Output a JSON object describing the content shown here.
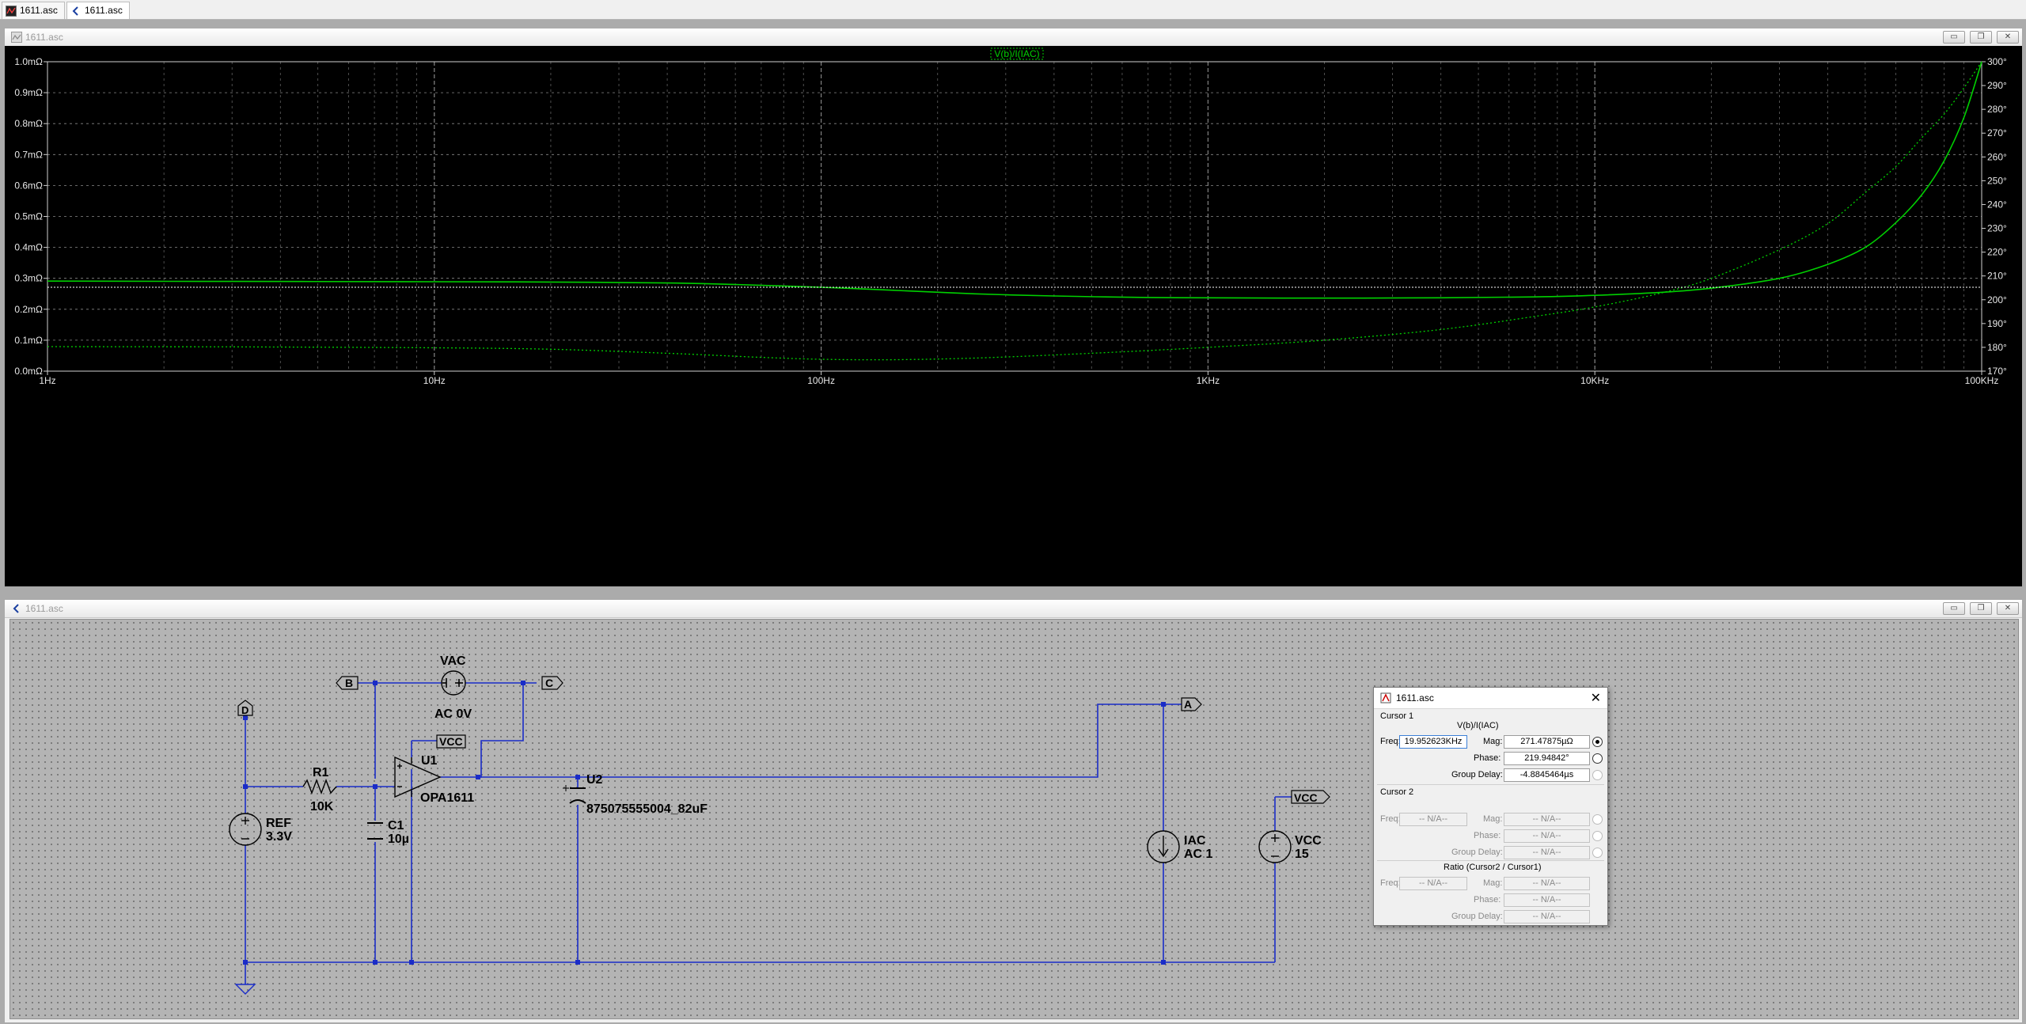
{
  "tabs": [
    {
      "label": "1611.asc",
      "icon": "waveform-icon"
    },
    {
      "label": "1611.asc",
      "icon": "schematic-icon"
    }
  ],
  "plot_window": {
    "title": "1611.asc",
    "buttons": {
      "minimize": "▭",
      "restore": "❐",
      "close": "✕"
    }
  },
  "schematic_window": {
    "title": "1611.asc",
    "buttons": {
      "minimize": "▭",
      "restore": "❐",
      "close": "✕"
    }
  },
  "chart_data": {
    "type": "line",
    "trace_label": "V(b)/I(IAC)",
    "x_scale": "log",
    "xlim": [
      1,
      100000
    ],
    "x_ticks": [
      {
        "v": 1,
        "label": "1Hz"
      },
      {
        "v": 10,
        "label": "10Hz"
      },
      {
        "v": 100,
        "label": "100Hz"
      },
      {
        "v": 1000,
        "label": "1KHz"
      },
      {
        "v": 10000,
        "label": "10KHz"
      },
      {
        "v": 100000,
        "label": "100KHz"
      }
    ],
    "y_left_ticks": [
      "0.0mΩ",
      "0.1mΩ",
      "0.2mΩ",
      "0.3mΩ",
      "0.4mΩ",
      "0.5mΩ",
      "0.6mΩ",
      "0.7mΩ",
      "0.8mΩ",
      "0.9mΩ",
      "1.0mΩ"
    ],
    "y_left_range": [
      0,
      1.0
    ],
    "y_right_ticks": [
      "170°",
      "180°",
      "190°",
      "200°",
      "210°",
      "220°",
      "230°",
      "240°",
      "250°",
      "260°",
      "270°",
      "280°",
      "290°",
      "300°"
    ],
    "y_right_range": [
      170,
      300
    ],
    "trace_color": "#00d000",
    "grid": true,
    "series": [
      {
        "name": "Mag",
        "unit": "mΩ",
        "points": [
          [
            1,
            0.291
          ],
          [
            3,
            0.29
          ],
          [
            10,
            0.289
          ],
          [
            20,
            0.288
          ],
          [
            40,
            0.285
          ],
          [
            60,
            0.28
          ],
          [
            100,
            0.271
          ],
          [
            150,
            0.262
          ],
          [
            250,
            0.25
          ],
          [
            400,
            0.243
          ],
          [
            700,
            0.238
          ],
          [
            1000,
            0.237
          ],
          [
            2000,
            0.236
          ],
          [
            4000,
            0.237
          ],
          [
            7000,
            0.24
          ],
          [
            10000,
            0.245
          ],
          [
            15000,
            0.255
          ],
          [
            20000,
            0.268
          ],
          [
            30000,
            0.3
          ],
          [
            40000,
            0.345
          ],
          [
            50000,
            0.4
          ],
          [
            60000,
            0.48
          ],
          [
            70000,
            0.57
          ],
          [
            80000,
            0.68
          ],
          [
            90000,
            0.82
          ],
          [
            100000,
            1.0
          ]
        ]
      },
      {
        "name": "Phase",
        "unit": "°",
        "style": "dotted",
        "points": [
          [
            1,
            180.3
          ],
          [
            3,
            180.2
          ],
          [
            10,
            179.8
          ],
          [
            20,
            179.2
          ],
          [
            40,
            177.5
          ],
          [
            70,
            175.8
          ],
          [
            100,
            175.0
          ],
          [
            150,
            174.8
          ],
          [
            250,
            175.5
          ],
          [
            500,
            177.5
          ],
          [
            1000,
            180.0
          ],
          [
            2000,
            183.0
          ],
          [
            4000,
            187.5
          ],
          [
            7000,
            193.0
          ],
          [
            10000,
            197.0
          ],
          [
            15000,
            203.0
          ],
          [
            20000,
            209.0
          ],
          [
            30000,
            221.0
          ],
          [
            40000,
            232.0
          ],
          [
            50000,
            245.0
          ],
          [
            60000,
            256.0
          ],
          [
            70000,
            268.0
          ],
          [
            80000,
            278.0
          ],
          [
            90000,
            289.0
          ],
          [
            100000,
            300.0
          ]
        ]
      }
    ],
    "cursor_level": 0.271
  },
  "schematic": {
    "labels": {
      "vac": "VAC",
      "vac_val": "AC 0V",
      "r1": "R1",
      "r1_val": "10K",
      "c1": "C1",
      "c1_val": "10µ",
      "u1": "U1",
      "u1_val": "OPA1611",
      "u2": "U2",
      "u2_val": "875075555004_82uF",
      "ref": "REF",
      "ref_val": "3.3V",
      "iac": "IAC",
      "iac_val": "AC 1",
      "vcc_src": "VCC",
      "vcc_val": "15"
    },
    "net_flags": {
      "b": "B",
      "c": "C",
      "d": "D",
      "a": "A",
      "vcc1": "VCC",
      "vcc2": "VCC"
    }
  },
  "cursor_dialog": {
    "title": "1611.asc",
    "close": "✕",
    "cursor1_header": "Cursor 1",
    "trace_name": "V(b)/I(IAC)",
    "freq_label": "Freq:",
    "freq_value": "19.952623KHz",
    "mag_label": "Mag:",
    "mag_value": "271.47875µΩ",
    "phase_label": "Phase:",
    "phase_value": "219.94842°",
    "gd_label": "Group Delay:",
    "gd_value": "-4.8845464µs",
    "cursor2_header": "Cursor 2",
    "na": "-- N/A--",
    "ratio_header": "Ratio (Cursor2 / Cursor1)"
  }
}
